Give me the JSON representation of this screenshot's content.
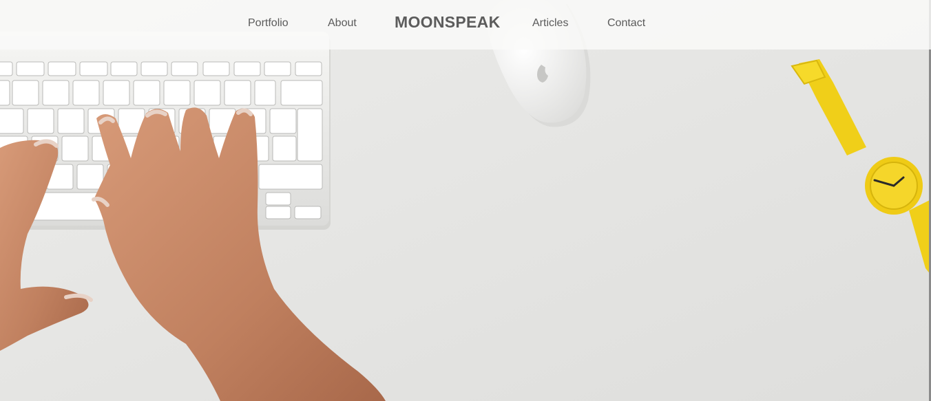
{
  "nav": {
    "links": [
      {
        "label": "Portfolio"
      },
      {
        "label": "About"
      },
      {
        "label": "Articles"
      },
      {
        "label": "Contact"
      }
    ],
    "brand": "MOONSPEAK"
  },
  "hero": {
    "image": "desk-keyboard-hands-mouse-yellow-watch-photo"
  },
  "colors": {
    "nav_text": "#5a5a5a",
    "nav_bg": "#fafaf9",
    "desk": "#e6e6e4",
    "watch_yellow": "#f2d21b",
    "skin": "#c98868"
  }
}
